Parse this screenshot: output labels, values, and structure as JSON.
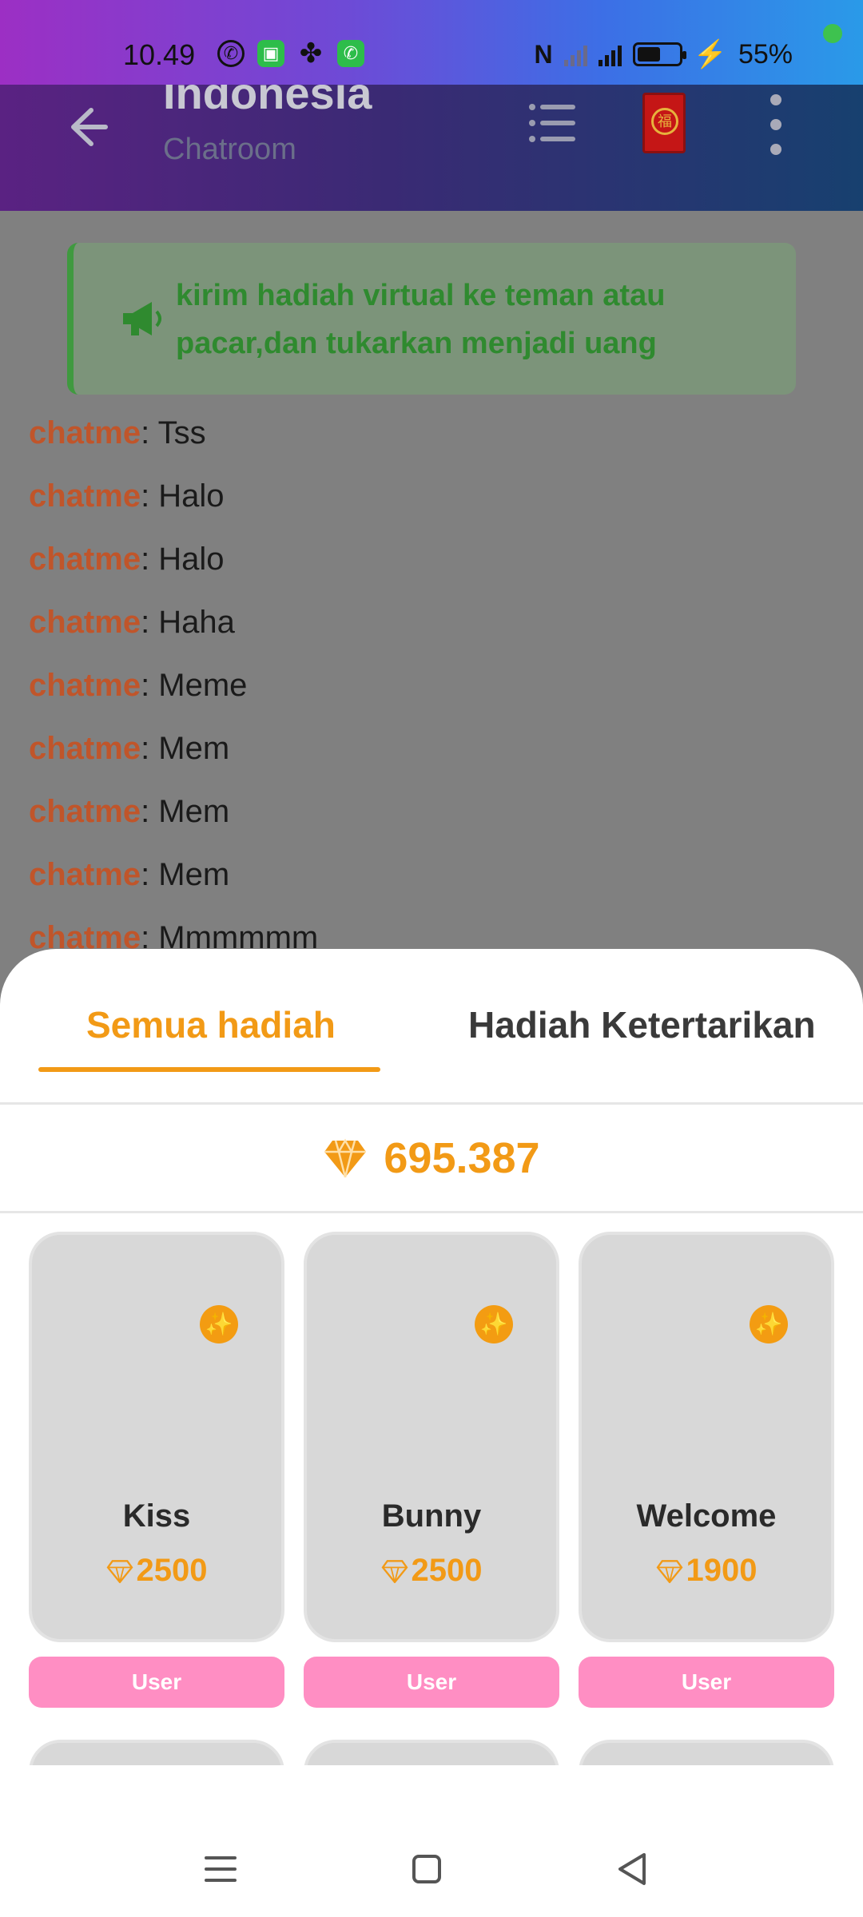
{
  "status_bar": {
    "time": "10.49",
    "battery_percent": "55%",
    "network": "4G"
  },
  "app_bar": {
    "title": "Indonesia",
    "subtitle": "Chatroom",
    "icons": [
      "back-arrow-icon",
      "list-icon",
      "red-envelope-icon",
      "more-vert-icon"
    ]
  },
  "announcement": {
    "text": "kirim hadiah virtual ke teman atau pacar,dan  tukarkan menjadi uang"
  },
  "chat": {
    "messages": [
      {
        "user": "chatme",
        "text": ": Tss"
      },
      {
        "user": "chatme",
        "text": ": Halo"
      },
      {
        "user": "chatme",
        "text": ": Halo"
      },
      {
        "user": "chatme",
        "text": ": Haha"
      },
      {
        "user": "chatme",
        "text": ": Meme"
      },
      {
        "user": "chatme",
        "text": ": Mem"
      },
      {
        "user": "chatme",
        "text": ": Mem"
      },
      {
        "user": "chatme",
        "text": ": Mem"
      },
      {
        "user": "chatme",
        "text": ": Mmmmmm"
      }
    ]
  },
  "gift_sheet": {
    "tabs": [
      {
        "label": "Semua hadiah",
        "active": true
      },
      {
        "label": "Hadiah Ketertarikan",
        "active": false
      }
    ],
    "balance": "695.387",
    "gifts": [
      {
        "name": "Kiss",
        "price": "2500",
        "tag": "User"
      },
      {
        "name": "Bunny",
        "price": "2500",
        "tag": "User"
      },
      {
        "name": "Welcome",
        "price": "1900",
        "tag": "User"
      }
    ]
  },
  "colors": {
    "accent": "#f29a16",
    "user_tag": "#ff8ec3",
    "username": "#c0552a",
    "announcement_text": "#2f8a2f"
  }
}
